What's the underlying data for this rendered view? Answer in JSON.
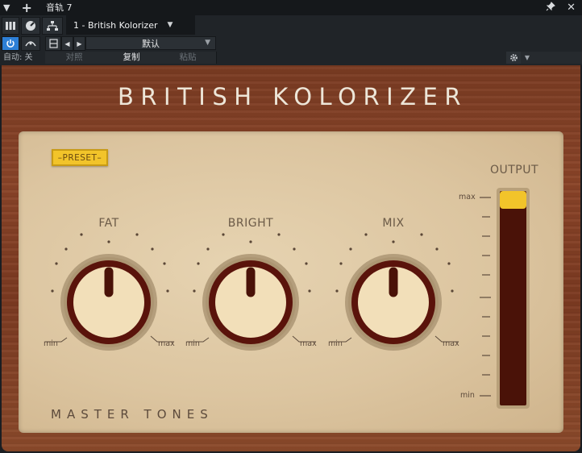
{
  "host": {
    "window_title": "音轨 7",
    "track_name": "1 - British Kolorizer",
    "preset_name": "默认",
    "auto_label": "自动: 关",
    "compare_label": "对照",
    "copy_label": "复制",
    "paste_label": "粘贴"
  },
  "plugin": {
    "title": "BRITISH KOLORIZER",
    "preset_button": "–PRESET–",
    "output_label": "OUTPUT",
    "meter_max": "max",
    "meter_min": "min",
    "brand": "MASTER TONES",
    "output_level": 1.0,
    "accent_color": "#f2c42a",
    "knobs": [
      {
        "label": "FAT",
        "min_label": "min",
        "max_label": "max"
      },
      {
        "label": "BRIGHT",
        "min_label": "min",
        "max_label": "max"
      },
      {
        "label": "MIX",
        "min_label": "min",
        "max_label": "max"
      }
    ]
  }
}
